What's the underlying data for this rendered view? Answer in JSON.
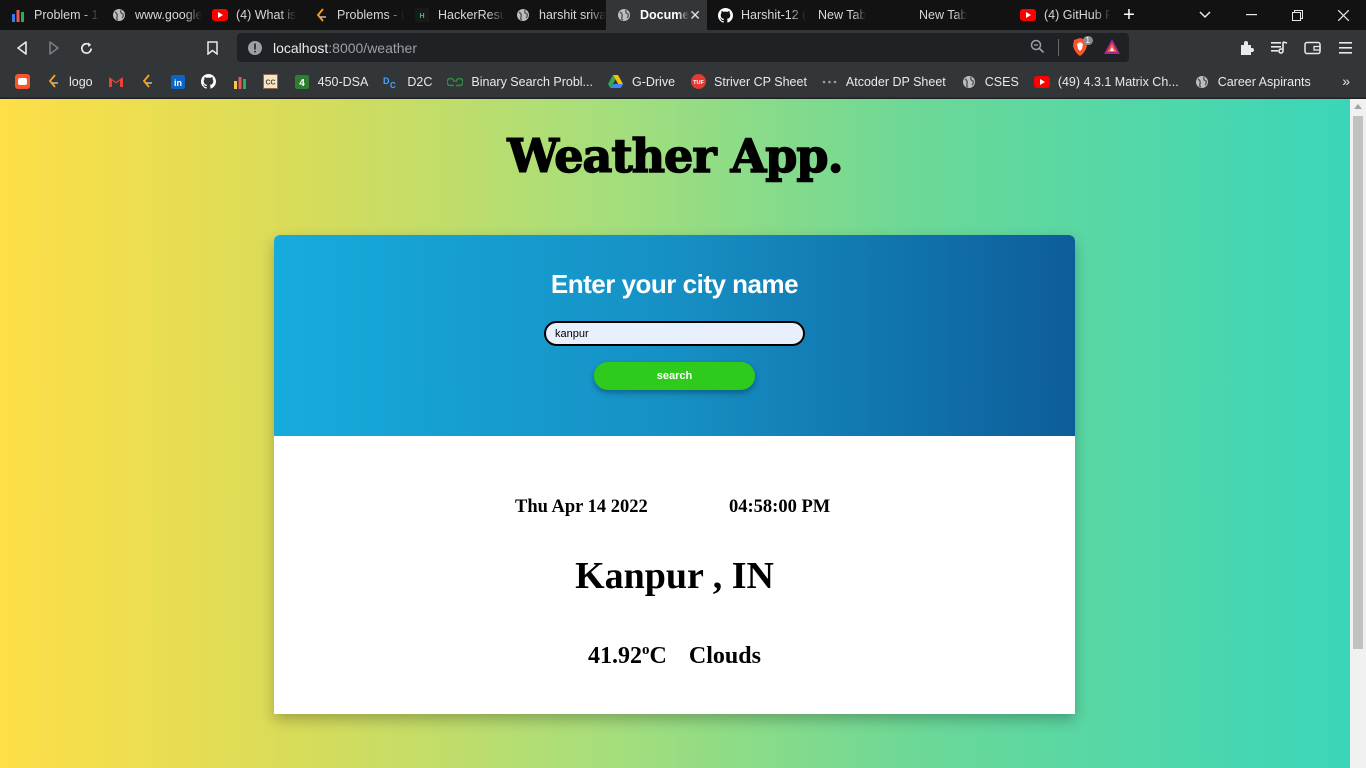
{
  "browser": {
    "tabs": [
      {
        "title": "Problem - 1",
        "icon": "bar-chart-icon",
        "color": "#2f80ed"
      },
      {
        "title": "www.google",
        "icon": "globe-icon",
        "color": "#bdbdbd"
      },
      {
        "title": "(4) What is",
        "icon": "youtube-icon",
        "color": "#ff0000"
      },
      {
        "title": "Problems - I",
        "icon": "leetcode-icon",
        "color": "#ffa116"
      },
      {
        "title": "HackerResu",
        "icon": "hackerrank-icon",
        "color": "#2ec866"
      },
      {
        "title": "harshit sriva",
        "icon": "globe-icon",
        "color": "#bdbdbd"
      },
      {
        "title": "Docume",
        "icon": "globe-icon",
        "color": "#bdbdbd",
        "active": true
      },
      {
        "title": "Harshit-12 (",
        "icon": "github-icon",
        "color": "#ffffff"
      },
      {
        "title": "New Tab",
        "icon": "",
        "color": ""
      },
      {
        "title": "New Tab",
        "icon": "",
        "color": ""
      },
      {
        "title": "(4) GitHub F",
        "icon": "youtube-icon",
        "color": "#ff0000"
      }
    ],
    "new_tab_label": "+",
    "address": {
      "host": "localhost",
      "rest": ":8000/weather"
    },
    "shields_count": "1",
    "bookmarks": [
      {
        "label": "",
        "icon": "brave-icon",
        "color": "#fb542b"
      },
      {
        "label": "logo",
        "icon": "leetcode-icon",
        "color": "#ffa116"
      },
      {
        "label": "",
        "icon": "gmail-icon",
        "color": "#ea4335"
      },
      {
        "label": "",
        "icon": "leetcode-icon",
        "color": "#ffa116"
      },
      {
        "label": "",
        "icon": "linkedin-icon",
        "color": "#0a66c2"
      },
      {
        "label": "",
        "icon": "github-icon",
        "color": "#ffffff"
      },
      {
        "label": "",
        "icon": "bar-chart-icon",
        "color": "#f2c94c"
      },
      {
        "label": "",
        "icon": "codechef-icon",
        "color": "#8b6b4a"
      },
      {
        "label": "450-DSA",
        "icon": "four-icon",
        "color": "#2e7d32"
      },
      {
        "label": "D2C",
        "icon": "d2c-icon",
        "color": "#4aa3ff"
      },
      {
        "label": "Binary Search Probl...",
        "icon": "gfg-icon",
        "color": "#2f8d46"
      },
      {
        "label": "G-Drive",
        "icon": "drive-icon",
        "color": "#34a853"
      },
      {
        "label": "Striver CP Sheet",
        "icon": "tuf-icon",
        "color": "#e53935"
      },
      {
        "label": "Atcoder DP Sheet",
        "icon": "dots-icon",
        "color": "#9e9e9e"
      },
      {
        "label": "CSES",
        "icon": "globe-icon",
        "color": "#bdbdbd"
      },
      {
        "label": "(49) 4.3.1 Matrix Ch...",
        "icon": "youtube-icon",
        "color": "#ff0000"
      },
      {
        "label": "Career Aspirants",
        "icon": "globe-icon",
        "color": "#bdbdbd"
      }
    ]
  },
  "page": {
    "title": "Weather App.",
    "form": {
      "heading": "Enter your city name",
      "city_value": "kanpur",
      "search_label": "search"
    },
    "result": {
      "date": "Thu Apr 14 2022",
      "time": "04:58:00 PM",
      "city": "Kanpur , IN",
      "temperature": "41.92",
      "degree": "o",
      "unit": "C",
      "condition": "Clouds"
    }
  },
  "colors": {
    "gradient_left": "#fedf47",
    "gradient_right": "#3ad6b9",
    "card_top_left": "#17abdc",
    "card_top_right": "#0d5d9a",
    "search_button": "#2fcb1c"
  }
}
